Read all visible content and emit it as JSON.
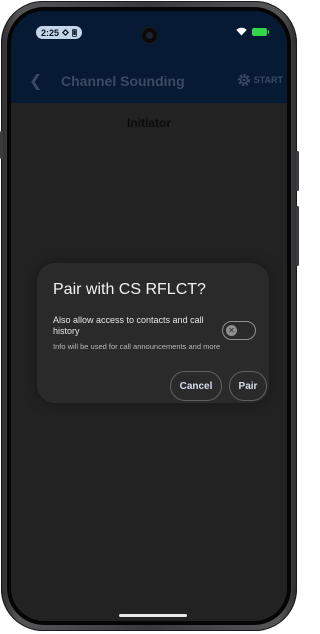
{
  "status_bar": {
    "time": "2:25",
    "battery_color": "#32d74b"
  },
  "app_bar": {
    "back_icon": "arrow-back-icon",
    "title": "Channel Sounding",
    "start_label": "START",
    "start_icon": "gear-icon"
  },
  "main": {
    "section_label": "Initiator"
  },
  "dialog": {
    "title": "Pair with CS RFLCT?",
    "option_text": "Also allow access to contacts and call history",
    "option_subtext": "Info will be used for call announcements and more",
    "toggle_on": false,
    "cancel_label": "Cancel",
    "pair_label": "Pair"
  }
}
